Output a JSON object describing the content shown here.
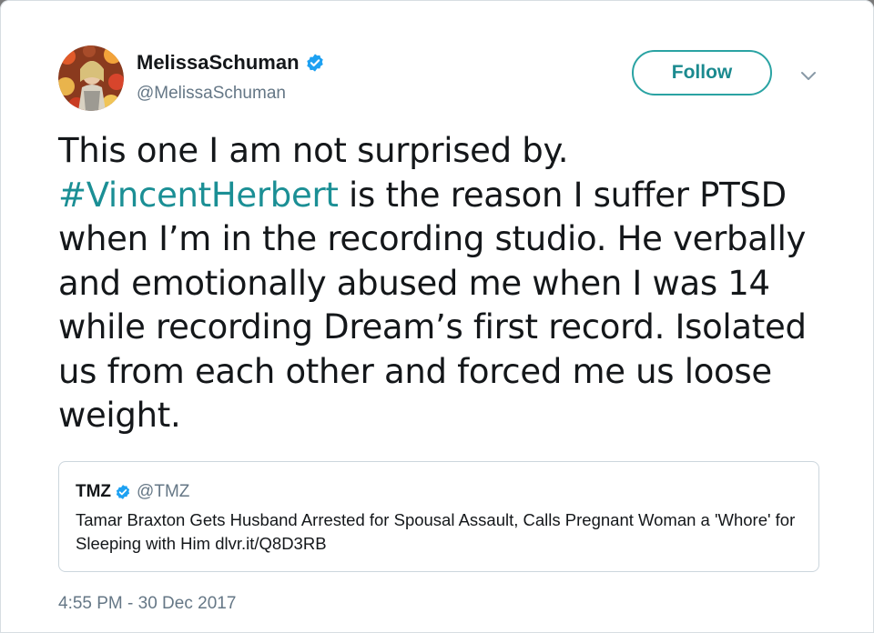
{
  "tweet": {
    "display_name": "MelissaSchuman",
    "handle": "@MelissaSchuman",
    "follow_label": "Follow",
    "text_before_hashtag": "This one I am not surprised by.",
    "hashtag": "#VincentHerbert",
    "text_after_hashtag": " is the reason I suffer PTSD when I’m in the recording studio. He verbally and emotionally abused me when I was 14 while recording Dream’s first record. Isolated us from each other and forced me us loose weight.",
    "timestamp": "4:55 PM - 30 Dec 2017"
  },
  "quoted_tweet": {
    "display_name": "TMZ",
    "handle": "@TMZ",
    "text": "Tamar Braxton Gets Husband Arrested for Spousal Assault, Calls Pregnant Woman a 'Whore' for Sleeping with Him dlvr.it/Q8D3RB"
  },
  "icons": {
    "verified": "verified-badge-icon",
    "caret": "chevron-down-icon"
  },
  "colors": {
    "accent": "#1b8f95",
    "verified_blue": "#1da1f2",
    "secondary_text": "#657786",
    "border": "#ccd6dd"
  }
}
